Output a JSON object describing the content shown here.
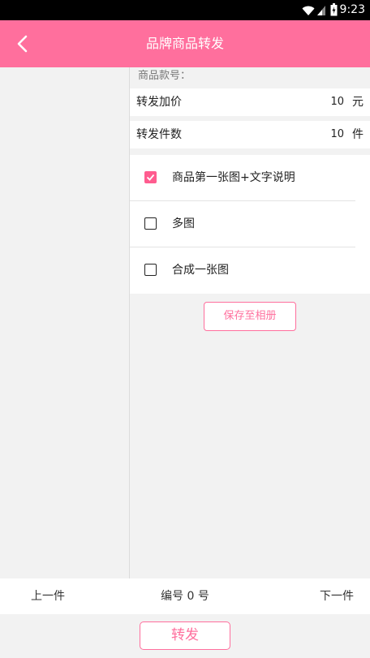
{
  "status_bar": {
    "time": "9:23"
  },
  "header": {
    "title": "品牌商品转发"
  },
  "form": {
    "product_no_label": "商品款号：",
    "price_label": "转发加价",
    "price_value": "10",
    "price_unit": "元",
    "count_label": "转发件数",
    "count_value": "10",
    "count_unit": "件"
  },
  "options": [
    {
      "label": "商品第一张图+文字说明",
      "checked": true
    },
    {
      "label": "多图",
      "checked": false
    },
    {
      "label": "合成一张图",
      "checked": false
    }
  ],
  "save_button": "保存至相册",
  "nav": {
    "prev": "上一件",
    "index_label": "编号 0 号",
    "next": "下一件"
  },
  "forward_button": "转发",
  "colors": {
    "accent": "#ff6f9d",
    "check": "#ff5c8f"
  }
}
